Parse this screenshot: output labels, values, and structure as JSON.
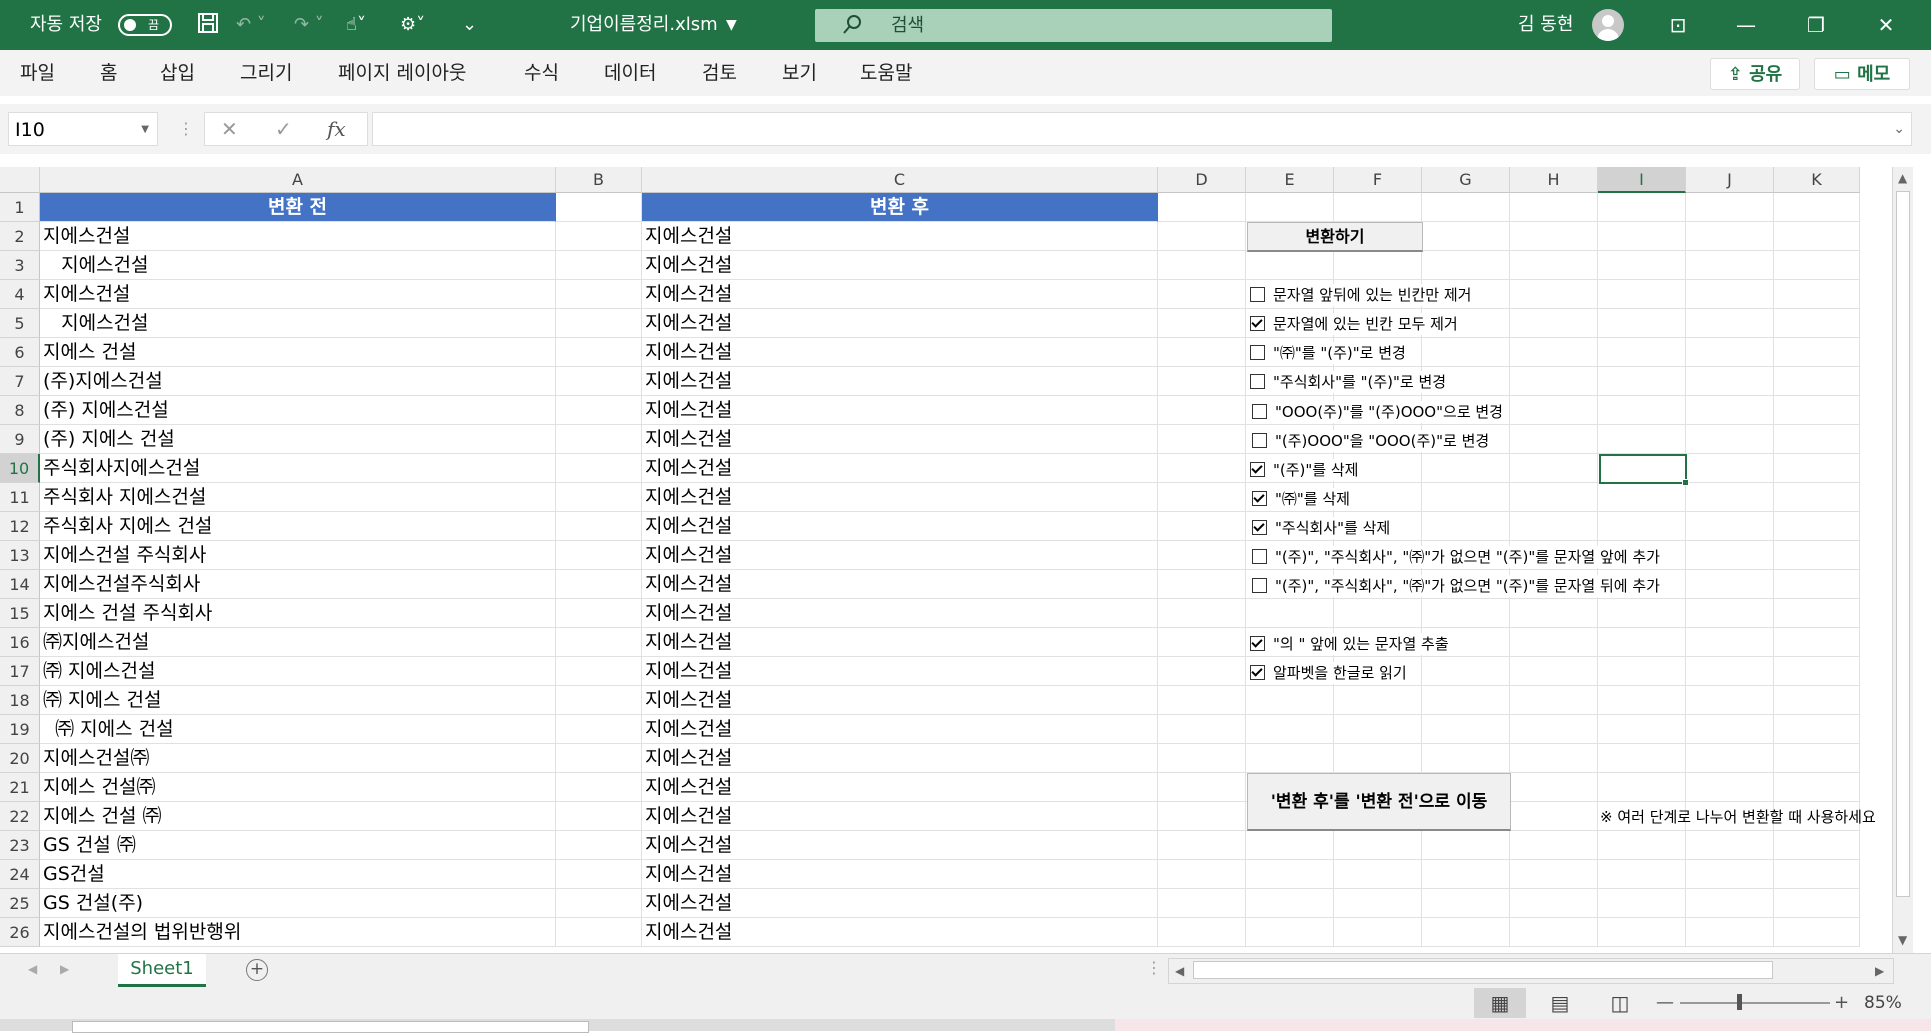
{
  "titlebar": {
    "autosave_label": "자동 저장",
    "autosave_state": "끔",
    "filename": "기업이름정리.xlsm",
    "search_placeholder": "검색",
    "user_name": "김 동현",
    "color": "#217346"
  },
  "menu": {
    "items": [
      "파일",
      "홈",
      "삽입",
      "그리기",
      "페이지 레이아웃",
      "수식",
      "데이터",
      "검토",
      "보기",
      "도움말"
    ],
    "share_label": "공유",
    "comment_label": "메모"
  },
  "formula_bar": {
    "name_box": "I10",
    "formula": ""
  },
  "columns": [
    "A",
    "B",
    "C",
    "D",
    "E",
    "F",
    "G",
    "H",
    "I",
    "J",
    "K"
  ],
  "selected_column": "I",
  "selected_row": "10",
  "rows": [
    "1",
    "2",
    "3",
    "4",
    "5",
    "6",
    "7",
    "8",
    "9",
    "10",
    "11",
    "12",
    "13",
    "14",
    "15",
    "16",
    "17",
    "18",
    "19",
    "20",
    "21",
    "22",
    "23",
    "24",
    "25",
    "26"
  ],
  "header": {
    "before": "변환 전",
    "after": "변환 후"
  },
  "before": [
    "지에스건설",
    "   지에스건설",
    "지에스건설",
    "   지에스건설",
    "지에스 건설",
    "(주)지에스건설",
    "(주) 지에스건설",
    "(주) 지에스 건설",
    "주식회사지에스건설",
    "주식회사 지에스건설",
    "주식회사 지에스 건설",
    "지에스건설 주식회사",
    "지에스건설주식회사",
    "지에스 건설 주식회사",
    "㈜지에스건설",
    "㈜ 지에스건설",
    "㈜ 지에스 건설",
    "  ㈜ 지에스 건설",
    "지에스건설㈜",
    "지에스 건설㈜",
    "지에스 건설 ㈜",
    "GS 건설 ㈜",
    "GS건설",
    "GS 건설(주)",
    "지에스건설의 법위반행위"
  ],
  "after": [
    "지에스건설",
    "지에스건설",
    "지에스건설",
    "지에스건설",
    "지에스건설",
    "지에스건설",
    "지에스건설",
    "지에스건설",
    "지에스건설",
    "지에스건설",
    "지에스건설",
    "지에스건설",
    "지에스건설",
    "지에스건설",
    "지에스건설",
    "지에스건설",
    "지에스건설",
    "지에스건설",
    "지에스건설",
    "지에스건설",
    "지에스건설",
    "지에스건설",
    "지에스건설",
    "지에스건설",
    "지에스건설"
  ],
  "controls": {
    "convert_button": "변환하기",
    "checkboxes": [
      {
        "label": "문자열 앞뒤에 있는 빈칸만 제거",
        "checked": false
      },
      {
        "label": "문자열에 있는 빈칸 모두 제거",
        "checked": true
      },
      {
        "label": "\"㈜\"를 \"(주)\"로 변경",
        "checked": false
      },
      {
        "label": "\"주식회사\"를 \"(주)\"로 변경",
        "checked": false
      },
      {
        "label": "\"OOO(주)\"를 \"(주)OOO\"으로 변경",
        "checked": false
      },
      {
        "label": "\"(주)OOO\"을 \"OOO(주)\"로 변경",
        "checked": false
      },
      {
        "label": "\"(주)\"를 삭제",
        "checked": true
      },
      {
        "label": "\"㈜\"를 삭제",
        "checked": true
      },
      {
        "label": "\"주식회사\"를 삭제",
        "checked": true
      },
      {
        "label": "\"(주)\", \"주식회사\", \"㈜\"가 없으면 \"(주)\"를 문자열 앞에 추가",
        "checked": false
      },
      {
        "label": "\"(주)\", \"주식회사\", \"㈜\"가 없으면 \"(주)\"를 문자열 뒤에 추가",
        "checked": false
      },
      {
        "label": "\"의 \" 앞에 있는 문자열 추출",
        "checked": true
      },
      {
        "label": "알파벳을 한글로 읽기",
        "checked": true
      }
    ],
    "move_button": "'변환 후'를 '변환 전'으로 이동",
    "note": "※ 여러 단계로 나누어 변환할 때 사용하세요"
  },
  "sheet_tab": "Sheet1",
  "zoom": "85%",
  "colors": {
    "header_fill": "#4472c4",
    "accent": "#217346"
  }
}
